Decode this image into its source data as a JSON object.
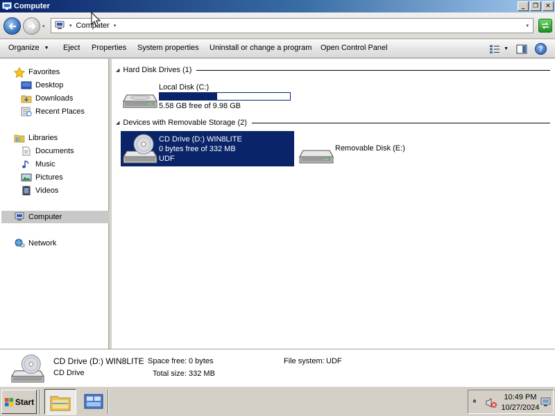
{
  "window": {
    "title": "Computer"
  },
  "title_buttons": {
    "minimize": "_",
    "restore": "❐",
    "close": "✕"
  },
  "address": {
    "crumb": "Computer",
    "sep_glyph": "▾",
    "dropdown_glyph": "▾"
  },
  "toolbar": {
    "organize": "Organize",
    "organize_caret": "▼",
    "eject": "Eject",
    "properties": "Properties",
    "system_properties": "System properties",
    "uninstall": "Uninstall or change a program",
    "control_panel": "Open Control Panel",
    "view_caret": "▼",
    "help": "?"
  },
  "sidebar": {
    "favorites": "Favorites",
    "desktop": "Desktop",
    "downloads": "Downloads",
    "recent": "Recent Places",
    "libraries": "Libraries",
    "documents": "Documents",
    "music": "Music",
    "pictures": "Pictures",
    "videos": "Videos",
    "computer": "Computer",
    "network": "Network"
  },
  "groups": {
    "hdd": "Hard Disk Drives (1)",
    "removable": "Devices with Removable Storage (2)",
    "collapse_glyph": "◢"
  },
  "drives": {
    "c": {
      "name": "Local Disk (C:)",
      "free": "5.58 GB free of 9.98 GB",
      "used_fraction": 0.44
    },
    "d": {
      "name": "CD Drive (D:) WIN8LITE",
      "free": "0 bytes free of 332 MB",
      "fs": "UDF"
    },
    "e": {
      "name": "Removable Disk (E:)"
    }
  },
  "details": {
    "name": "CD Drive (D:) WIN8LITE",
    "type": "CD Drive",
    "space_free_label": "Space free:",
    "space_free_value": "0 bytes",
    "total_size_label": "Total size:",
    "total_size_value": "332 MB",
    "fs_label": "File system:",
    "fs_value": "UDF"
  },
  "taskbar": {
    "start": "Start",
    "chevron": "«",
    "time": "10:49 PM",
    "date": "10/27/2024"
  },
  "colors": {
    "selection": "#0a246a",
    "title_start": "#0a246a",
    "title_end": "#a6caf0"
  }
}
